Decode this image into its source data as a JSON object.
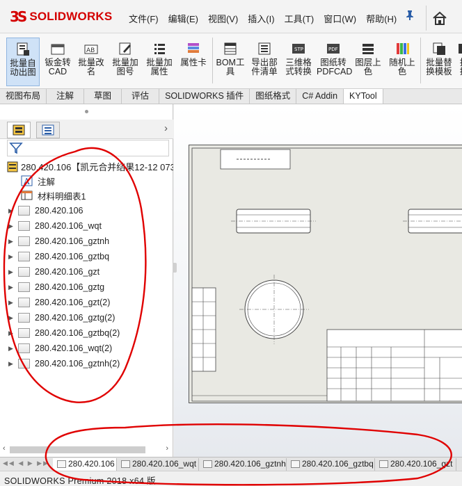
{
  "app": {
    "logo_mark": "3S",
    "logo_text": "SOLIDWORKS"
  },
  "menu": [
    "文件(F)",
    "编辑(E)",
    "视图(V)",
    "插入(I)",
    "工具(T)",
    "窗口(W)",
    "帮助(H)"
  ],
  "ribbon": [
    {
      "label1": "批量自",
      "label2": "动出图",
      "icon": "batch-auto-drawing-icon"
    },
    {
      "label1": "钣金转",
      "label2": "CAD",
      "icon": "sheetmetal-to-cad-icon"
    },
    {
      "label1": "批量改",
      "label2": "名",
      "icon": "batch-rename-icon"
    },
    {
      "label1": "批量加",
      "label2": "图号",
      "icon": "batch-drawing-number-icon"
    },
    {
      "label1": "批量加",
      "label2": "属性",
      "icon": "batch-properties-icon"
    },
    {
      "label1": "属性卡",
      "label2": "",
      "icon": "property-card-icon"
    },
    {
      "label1": "BOM工",
      "label2": "具",
      "icon": "bom-tool-icon"
    },
    {
      "label1": "导出部",
      "label2": "件清单",
      "icon": "export-parts-list-icon"
    },
    {
      "label1": "三维格",
      "label2": "式转换",
      "icon": "3d-format-convert-icon"
    },
    {
      "label1": "图纸转",
      "label2": "PDFCAD",
      "icon": "drawing-to-pdfcad-icon"
    },
    {
      "label1": "图层上",
      "label2": "色",
      "icon": "layer-color-icon"
    },
    {
      "label1": "随机上",
      "label2": "色",
      "icon": "random-color-icon"
    },
    {
      "label1": "批量替",
      "label2": "换模板",
      "icon": "batch-replace-template-icon"
    },
    {
      "label1": "批",
      "label2": "换",
      "icon": "batch-icon"
    }
  ],
  "tabs": [
    "视图布局",
    "注解",
    "草图",
    "评估",
    "SOLIDWORKS 插件",
    "图纸格式",
    "C# Addin",
    "KYTool"
  ],
  "tree": {
    "root": "280.420.106【凯元合并结果12-12 073",
    "annotation": "注解",
    "bom": "材料明细表1",
    "sheets": [
      "280.420.106",
      "280.420.106_wqt",
      "280.420.106_gztnh",
      "280.420.106_gztbq",
      "280.420.106_gzt",
      "280.420.106_gztg",
      "280.420.106_gzt(2)",
      "280.420.106_gztg(2)",
      "280.420.106_gztbq(2)",
      "280.420.106_wqt(2)",
      "280.420.106_gztnh(2)"
    ]
  },
  "sheet_tabs": [
    "280.420.106",
    "280.420.106_wqt",
    "280.420.106_gztnh",
    "280.420.106_gztbq",
    "280.420.106_gzt"
  ],
  "status": {
    "text": "SOLIDWORKS Premium 2018 x64 版"
  },
  "colors": {
    "brand": "#d40000",
    "annotation": "#e00000",
    "selected_tab": "#ffffff"
  }
}
